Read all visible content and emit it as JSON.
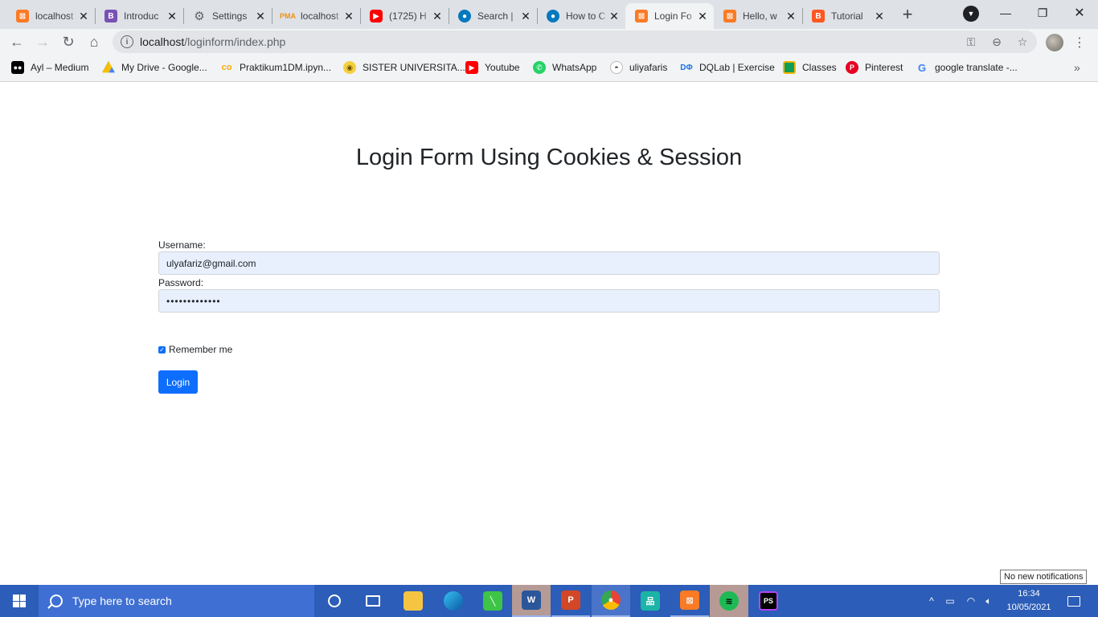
{
  "browser": {
    "tabs": [
      {
        "title": "localhost",
        "favicon": "xampp-icon",
        "active": false
      },
      {
        "title": "Introduc",
        "favicon": "bootstrap-icon",
        "active": false
      },
      {
        "title": "Settings",
        "favicon": "gear-icon",
        "active": false
      },
      {
        "title": "localhost",
        "favicon": "phpmyadmin-icon",
        "active": false
      },
      {
        "title": "(1725) H",
        "favicon": "youtube-icon",
        "active": false
      },
      {
        "title": "Search |",
        "favicon": "drupal-icon",
        "active": false
      },
      {
        "title": "How to C",
        "favicon": "drupal-icon",
        "active": false
      },
      {
        "title": "Login Fo",
        "favicon": "xampp-icon",
        "active": true
      },
      {
        "title": "Hello, w",
        "favicon": "xampp-icon",
        "active": false
      },
      {
        "title": "Tutorial",
        "favicon": "blogger-icon",
        "active": false
      }
    ],
    "address": {
      "host": "localhost",
      "path": "/loginform/index.php"
    },
    "bookmarks": [
      {
        "label": "Ayl – Medium",
        "icon": "medium-icon"
      },
      {
        "label": "My Drive - Google...",
        "icon": "google-drive-icon"
      },
      {
        "label": "Praktikum1DM.ipyn...",
        "icon": "colab-icon"
      },
      {
        "label": "SISTER UNIVERSITA...",
        "icon": "university-icon"
      },
      {
        "label": "Youtube",
        "icon": "youtube-icon"
      },
      {
        "label": "WhatsApp",
        "icon": "whatsapp-icon"
      },
      {
        "label": "uliyafaris",
        "icon": "github-icon"
      },
      {
        "label": "DQLab | Exercise",
        "icon": "dqlab-icon"
      },
      {
        "label": "Classes",
        "icon": "classroom-icon"
      },
      {
        "label": "Pinterest",
        "icon": "pinterest-icon"
      },
      {
        "label": "google translate -...",
        "icon": "google-icon"
      }
    ]
  },
  "page": {
    "title": "Login Form Using Cookies & Session",
    "username_label": "Username:",
    "username_value": "ulyafariz@gmail.com",
    "password_label": "Password:",
    "password_value": "•••••••••••••",
    "remember_label": "Remember me",
    "remember_checked": true,
    "login_button": "Login"
  },
  "taskbar": {
    "search_placeholder": "Type here to search",
    "time": "16:34",
    "date": "10/05/2021",
    "notification_tooltip": "No new notifications"
  },
  "colors": {
    "primary": "#0d6efd",
    "taskbar": "#2c5db8",
    "autofill": "#e8f0fe"
  }
}
